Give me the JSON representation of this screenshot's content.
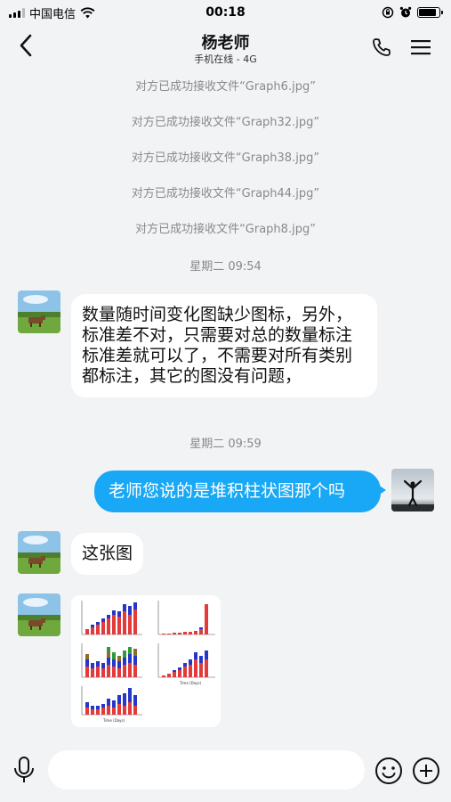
{
  "status_bar": {
    "carrier": "中国电信",
    "time": "00:18",
    "battery_level": 0.85
  },
  "header": {
    "contact_name": "杨老师",
    "status": "手机在线 - 4G"
  },
  "notices": [
    "对方已成功接收文件“Graph6.jpg”",
    "对方已成功接收文件“Graph32.jpg”",
    "对方已成功接收文件“Graph38.jpg”",
    "对方已成功接收文件“Graph44.jpg”",
    "对方已成功接收文件“Graph8.jpg”"
  ],
  "timestamps": [
    "星期二 09:54",
    "星期二 09:59"
  ],
  "messages": {
    "m1": "数量随时间变化图缺少图标，另外，标准差不对，只需要对总的数量标注标准差就可以了，不需要对所有类别都标注，其它的图没有问题，",
    "m2": "老师您说的是堆积柱状图那个吗",
    "m3": "这张图"
  },
  "input": {
    "value": "",
    "placeholder": ""
  },
  "colors": {
    "background": "#f2f3f5",
    "outgoing_bubble": "#18a8f5",
    "incoming_bubble": "#ffffff",
    "notice_text": "#8a8a8a"
  },
  "icons": [
    "signal-icon",
    "wifi-icon",
    "rotation-lock-icon",
    "alarm-icon",
    "battery-icon",
    "back-chevron-icon",
    "phone-icon",
    "menu-icon",
    "voice-icon",
    "emoji-icon",
    "plus-icon"
  ]
}
